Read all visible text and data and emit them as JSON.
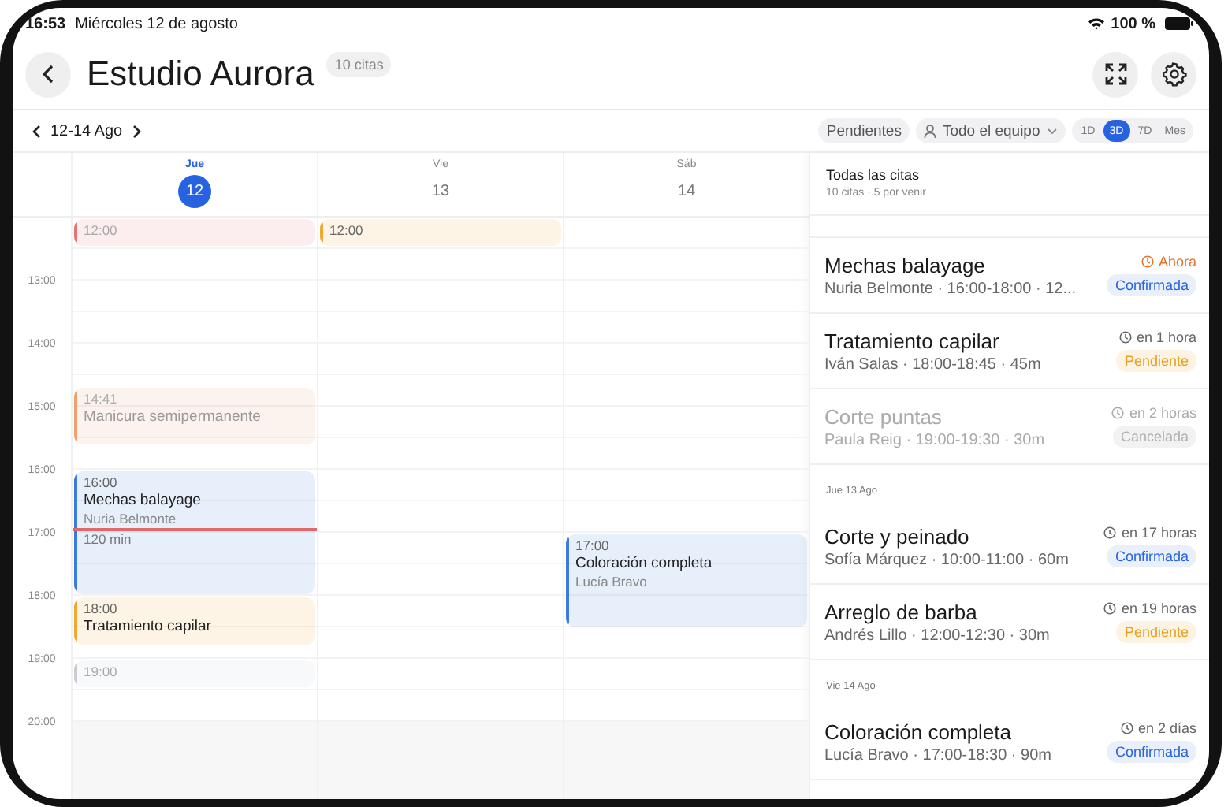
{
  "status_bar": {
    "time": "16:53",
    "date": "Miércoles 12 de agosto",
    "battery": "100 %"
  },
  "header": {
    "title": "Estudio Aurora",
    "badge": "10 citas"
  },
  "toolbar": {
    "range": "12-14 Ago",
    "filters": [
      {
        "kind": "chip",
        "label": "Pendientes"
      },
      {
        "kind": "dropdown",
        "label": "Todo el equipo"
      }
    ],
    "views": [
      {
        "label": "1D",
        "selected": false
      },
      {
        "label": "3D",
        "selected": true
      },
      {
        "label": "7D",
        "selected": false
      },
      {
        "label": "Mes",
        "selected": false
      }
    ]
  },
  "calendar": {
    "hours": [
      "13:00",
      "14:00",
      "15:00",
      "16:00",
      "17:00",
      "18:00",
      "19:00",
      "20:00"
    ],
    "days": [
      {
        "weekday": "Jue",
        "day": "12",
        "selected": true,
        "events": [
          {
            "time": "12:00",
            "color": "#e57373",
            "muted": true
          },
          {
            "time": "14:41",
            "title": "Manicura semipermanente",
            "color": "#f0a070",
            "muted": true
          },
          {
            "time": "16:00",
            "title": "Mechas balayage",
            "client": "Nuria Belmonte",
            "duration": "120 min",
            "color": "#3b7be0",
            "muted": false
          },
          {
            "time": "18:00",
            "title": "Tratamiento capilar",
            "color": "#f0a830",
            "muted": false
          },
          {
            "time": "19:00",
            "color": "#c8ccd2",
            "muted": true
          }
        ]
      },
      {
        "weekday": "Vie",
        "day": "13",
        "selected": false,
        "events": [
          {
            "time": "12:00",
            "color": "#f0a830",
            "muted": false
          }
        ]
      },
      {
        "weekday": "Sáb",
        "day": "14",
        "selected": false,
        "events": [
          {
            "time": "17:00",
            "title": "Coloración completa",
            "client": "Lucía Bravo",
            "color": "#3b7be0",
            "muted": false
          }
        ]
      }
    ]
  },
  "list": {
    "title": "Todas las citas",
    "subtitle": "10 citas · 5 por venir",
    "groups": [
      {
        "items": [
          {
            "title": "Mechas balayage",
            "meta": "Nuria Belmonte · 16:00-18:00 · 12...",
            "when": "Ahora",
            "urgent": true,
            "status": {
              "label": "Confirmada",
              "kind": "confirmed"
            }
          },
          {
            "title": "Tratamiento capilar",
            "meta": "Iván Salas · 18:00-18:45 · 45m",
            "when": "en 1 hora",
            "urgent": false,
            "status": {
              "label": "Pendiente",
              "kind": "pending"
            }
          },
          {
            "title": "Corte puntas",
            "meta": "Paula Reig · 19:00-19:30 · 30m",
            "when": "en 2 horas",
            "urgent": false,
            "status": {
              "label": "Cancelada",
              "kind": "cancelled"
            }
          }
        ]
      },
      {
        "heading": "Jue 13 Ago",
        "items": [
          {
            "title": "Corte y peinado",
            "meta": "Sofía Márquez · 10:00-11:00 · 60m",
            "when": "en 17 horas",
            "urgent": false,
            "status": {
              "label": "Confirmada",
              "kind": "confirmed"
            }
          },
          {
            "title": "Arreglo de barba",
            "meta": "Andrés Lillo · 12:00-12:30 · 30m",
            "when": "en 19 horas",
            "urgent": false,
            "status": {
              "label": "Pendiente",
              "kind": "pending"
            }
          }
        ]
      },
      {
        "heading": "Vie 14 Ago",
        "items": [
          {
            "title": "Coloración completa",
            "meta": "Lucía Bravo · 17:00-18:30 · 90m",
            "when": "en 2 días",
            "urgent": false,
            "status": {
              "label": "Confirmada",
              "kind": "confirmed"
            }
          }
        ]
      }
    ]
  }
}
